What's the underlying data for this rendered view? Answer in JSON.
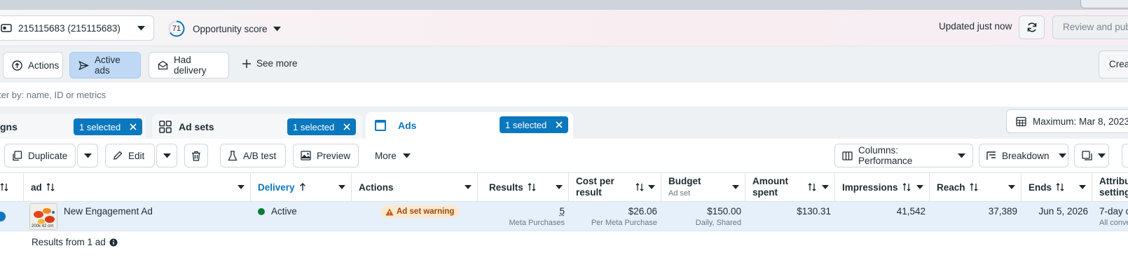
{
  "header": {
    "account_label": "215115683 (215115683)",
    "opportunity_score": "71",
    "opportunity_label": "Opportunity score",
    "updated_text": "Updated just now",
    "review_button": "Review and publish"
  },
  "filters": {
    "chips": [
      {
        "label": "Actions",
        "icon": "arrow-up-circle-icon"
      },
      {
        "label": "Active ads",
        "icon": "send-icon"
      },
      {
        "label": "Had delivery",
        "icon": "envelope-icon"
      }
    ],
    "see_more": "See more",
    "create_button": "Create"
  },
  "search": {
    "placeholder": "ter by: name, ID or metrics"
  },
  "tabs": [
    {
      "label": "gns",
      "selected_pill": "1 selected"
    },
    {
      "label": "Ad sets",
      "selected_pill": "1 selected"
    },
    {
      "label": "Ads",
      "selected_pill": "1 selected"
    }
  ],
  "date_range": "Maximum: Mar 8, 2023 – ",
  "toolbar": {
    "duplicate": "Duplicate",
    "edit": "Edit",
    "ab_test": "A/B test",
    "preview": "Preview",
    "more": "More",
    "columns": "Columns: Performance",
    "breakdown": "Breakdown"
  },
  "table": {
    "headers": {
      "ad": "ad",
      "delivery": "Delivery",
      "actions": "Actions",
      "results": "Results",
      "cost_per_result_1": "Cost per",
      "cost_per_result_2": "result",
      "budget": "Budget",
      "budget_sub": "Ad set",
      "amount_spent_1": "Amount",
      "amount_spent_2": "spent",
      "impressions": "Impressions",
      "reach": "Reach",
      "ends": "Ends",
      "attribution_1": "Attribu",
      "attribution_2": "setting"
    },
    "row": {
      "ad_name": "New Engagement Ad",
      "delivery": "Active",
      "warning": "Ad set warning",
      "results": "5",
      "results_sub": "Meta Purchases",
      "cost": "$26.06",
      "cost_sub": "Per Meta Purchase",
      "budget": "$150.00",
      "budget_sub": "Daily, Shared",
      "amount_spent": "$130.31",
      "impressions": "41,542",
      "reach": "37,389",
      "ends": "Jun 5, 2026",
      "attribution": "7-day c",
      "attribution_sub": "All conve",
      "thumb_caption": "200k 42 cnt"
    },
    "footer": "Results from 1 ad"
  },
  "colors": {
    "brand_blue": "#0a78be",
    "active_green": "#0a7a36",
    "warning_bg": "#fde8cf",
    "row_highlight": "#e6f0fb"
  }
}
